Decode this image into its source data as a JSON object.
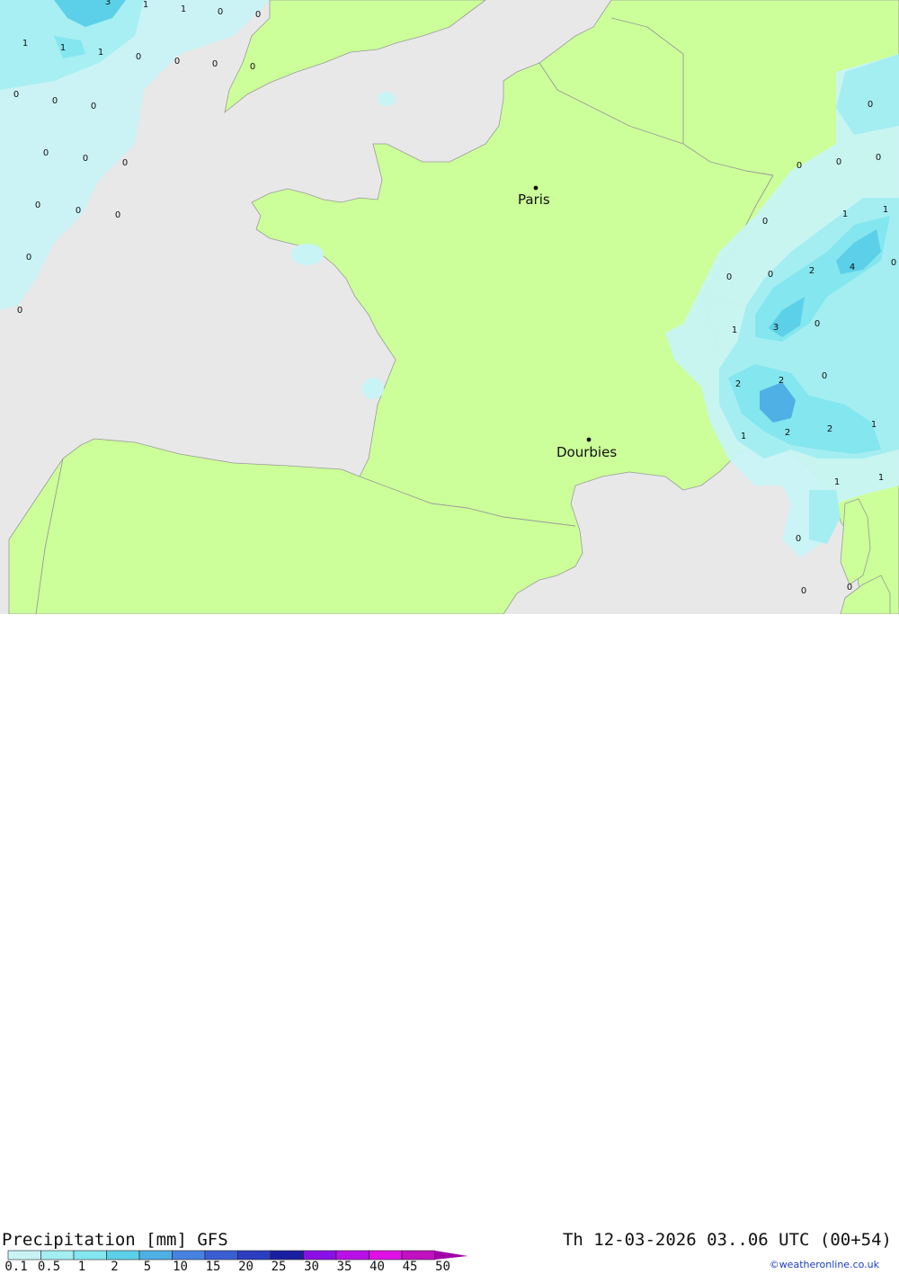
{
  "title": "Precipitation [mm] GFS",
  "datetime": "Th 12-03-2026 03..06 UTC (00+54)",
  "credit": "©weatheronline.co.uk",
  "cities": [
    {
      "name": "Paris"
    },
    {
      "name": "Dourbies"
    }
  ],
  "legend": {
    "ticks": [
      "0.1",
      "0.5",
      "1",
      "2",
      "5",
      "10",
      "15",
      "20",
      "25",
      "30",
      "35",
      "40",
      "45",
      "50"
    ],
    "colors": [
      "#c8f4f6",
      "#a4eef2",
      "#84e6ee",
      "#5cd0e8",
      "#4fb0e6",
      "#4682e0",
      "#3a5ed4",
      "#2c3ec0",
      "#1a1ea0",
      "#8a10e6",
      "#b810e6",
      "#e010e6",
      "#c010c0",
      "#a000a8"
    ]
  },
  "colors": {
    "sea": "#e8e8e8",
    "land": "#ccff99",
    "border": "#9a9a9a"
  },
  "values": [
    "3",
    "1",
    "1",
    "0",
    "0",
    "1",
    "1",
    "1",
    "0",
    "0",
    "0",
    "0",
    "0",
    "0",
    "0",
    "0",
    "0",
    "0",
    "0",
    "0",
    "0",
    "0",
    "0",
    "0",
    "0",
    "0",
    "0",
    "1",
    "1",
    "0",
    "0",
    "0",
    "2",
    "4",
    "0",
    "1",
    "3",
    "0",
    "0",
    "2",
    "2",
    "1",
    "2",
    "2",
    "1",
    "1",
    "1",
    "0",
    "0",
    "0"
  ]
}
